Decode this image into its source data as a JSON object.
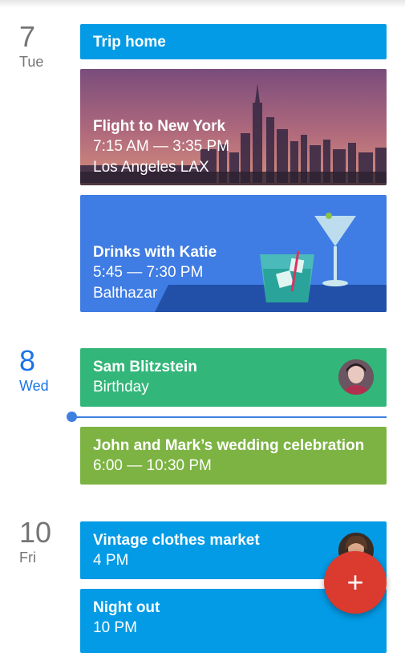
{
  "days": [
    {
      "num": "7",
      "dow": "Tue"
    },
    {
      "num": "8",
      "dow": "Wed"
    },
    {
      "num": "10",
      "dow": "Fri"
    }
  ],
  "events": {
    "trip": {
      "title": "Trip home"
    },
    "flight": {
      "title": "Flight to New York",
      "time": "7:15 AM — 3:35 PM",
      "place": "Los Angeles LAX"
    },
    "drinks": {
      "title": "Drinks with Katie",
      "time": "5:45 — 7:30 PM",
      "place": "Balthazar"
    },
    "sam": {
      "title": "Sam Blitzstein",
      "sub": "Birthday"
    },
    "wedding": {
      "title": "John and Mark’s wedding celebration",
      "time": "6:00 — 10:30 PM"
    },
    "market": {
      "title": "Vintage clothes market",
      "time": "4 PM"
    },
    "night": {
      "title": "Night out",
      "time": "10 PM"
    }
  },
  "fab": {
    "label": "+"
  }
}
